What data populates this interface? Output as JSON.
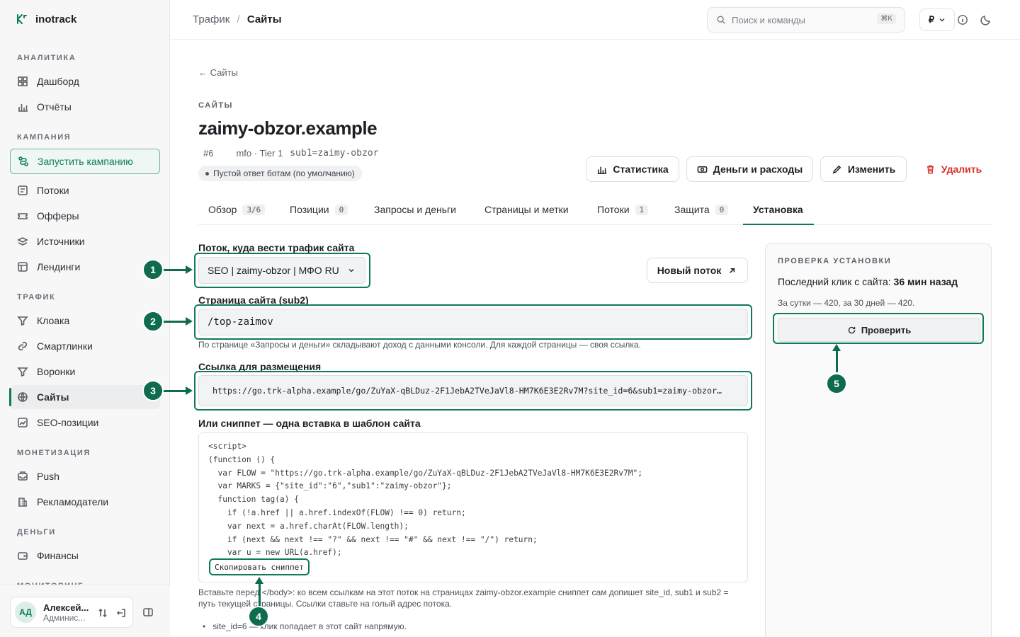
{
  "app": {
    "name": "inotrack"
  },
  "sidebar": {
    "sections": {
      "analytics": "АНАЛИТИКА",
      "campaigns": "КАМПАНИЯ",
      "traffic": "ТРАФИК",
      "monetization": "МОНЕТИЗАЦИЯ",
      "money": "ДЕНЬГИ",
      "monitoring": "МОНИТОРИНГ"
    },
    "items": {
      "dashboard": "Дашборд",
      "reports": "Отчёты",
      "launch": "Запустить кампанию",
      "streams": "Потоки",
      "offers": "Офферы",
      "sources": "Источники",
      "landings": "Лендинги",
      "cloaka": "Клоака",
      "smartlinks": "Смартлинки",
      "funnels": "Воронки",
      "sites": "Сайты",
      "seo": "SEO-позиции",
      "push": "Push",
      "advertisers": "Рекламодатели",
      "finance": "Финансы"
    },
    "user": {
      "initials": "АД",
      "name": "Алексей...",
      "role": "Админис..."
    }
  },
  "topbar": {
    "crumb_parent": "Трафик",
    "crumb_sep": "/",
    "crumb_current": "Сайты",
    "search_placeholder": "Поиск и команды",
    "search_kbd": "⌘K",
    "currency": "₽"
  },
  "page": {
    "back": "← Сайты",
    "eyebrow": "САЙТЫ",
    "title": "zaimy-obzor.example",
    "id": "#6",
    "meta": "mfo · Tier 1",
    "sub1": "sub1=zaimy-obzor",
    "bots_badge": "Пустой ответ ботам (по умолчанию)"
  },
  "actions": {
    "stats": "Статистика",
    "money": "Деньги и расходы",
    "edit": "Изменить",
    "delete": "Удалить"
  },
  "tabs": [
    {
      "label": "Обзор",
      "count": "3/6"
    },
    {
      "label": "Позиции",
      "count": "0"
    },
    {
      "label": "Запросы и деньги",
      "count": ""
    },
    {
      "label": "Страницы и метки",
      "count": ""
    },
    {
      "label": "Потоки",
      "count": "1"
    },
    {
      "label": "Защита",
      "count": "0"
    },
    {
      "label": "Установка",
      "count": ""
    }
  ],
  "install": {
    "stream_label": "Поток, куда вести трафик сайта",
    "stream_value": "SEO | zaimy-obzor | МФО RU",
    "new_stream": "Новый поток",
    "page_label": "Страница сайта (sub2)",
    "page_value": "/top-zaimov",
    "page_hint": "По странице «Запросы и деньги» складывают доход с данными консоли. Для каждой страницы — своя ссылка.",
    "link_label": "Ссылка для размещения",
    "link_value": "https://go.trk-alpha.example/go/ZuYaX-qBLDuz-2F1JebA2TVeJaVl8-HM7K6E3E2Rv7M?site_id=6&sub1=zaimy-obzor…",
    "snippet_label": "Или сниппет — одна вставка в шаблон сайта",
    "snippet_code": "<script>\n(function () {\n  var FLOW = \"https://go.trk-alpha.example/go/ZuYaX-qBLDuz-2F1JebA2TVeJaVl8-HM7K6E3E2Rv7M\";\n  var MARKS = {\"site_id\":\"6\",\"sub1\":\"zaimy-obzor\"};\n  function tag(a) {\n    if (!a.href || a.href.indexOf(FLOW) !== 0) return;\n    var next = a.href.charAt(FLOW.length);\n    if (next && next !== \"?\" && next !== \"#\" && next !== \"/\") return;\n    var u = new URL(a.href);",
    "copy_snippet": "Скопировать сниппет",
    "snippet_hint": "Вставьте перед </body>: ко всем ссылкам на этот поток на страницах zaimy-obzor.example сниппет сам допишет site_id, sub1 и sub2 = путь текущей страницы. Ссылки ставьте на голый адрес потока.",
    "bullet": "site_id=6 — клик попадает в этот сайт напрямую."
  },
  "check": {
    "eyebrow": "ПРОВЕРКА УСТАНОВКИ",
    "last_click_prefix": "Последний клик с сайта:",
    "last_click_value": "36 мин назад",
    "counts": "За сутки — 420, за 30 дней — 420.",
    "button": "Проверить"
  },
  "markers": [
    "1",
    "2",
    "3",
    "4",
    "5"
  ],
  "colors": {
    "accent": "#0f7a5a",
    "danger": "#d9302c"
  }
}
